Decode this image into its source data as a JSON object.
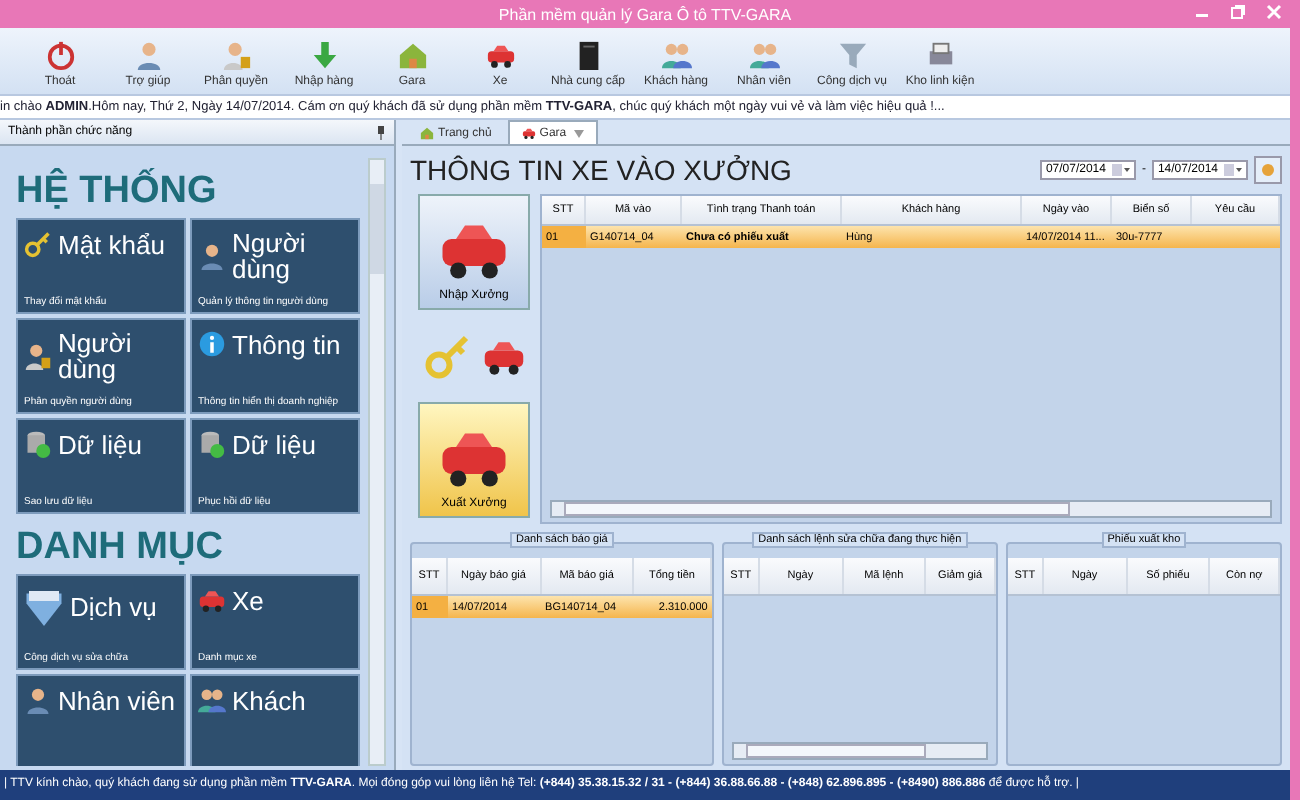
{
  "window": {
    "title": "Phần mềm quản lý Gara Ô tô TTV-GARA"
  },
  "toolbar": {
    "buttons": [
      {
        "label": "Thoát"
      },
      {
        "label": "Trợ giúp"
      },
      {
        "label": "Phân quyền"
      },
      {
        "label": "Nhập hàng"
      },
      {
        "label": "Gara"
      },
      {
        "label": "Xe"
      },
      {
        "label": "Nhà cung cấp"
      },
      {
        "label": "Khách hàng"
      },
      {
        "label": "Nhân viên"
      },
      {
        "label": "Công dịch vụ"
      },
      {
        "label": "Kho linh kiện"
      }
    ]
  },
  "marquee": "in chào **ADMIN**.Hôm nay, Thứ 2, Ngày 14/07/2014. Cám ơn quý khách đã sử dụng phần mềm **TTV-GARA**, chúc quý khách một ngày vui vẻ và làm  việc hiệu quả !...",
  "left_panel": {
    "title": "Thành phần chức năng",
    "sections": [
      {
        "heading": "HỆ THỐNG",
        "tiles": [
          {
            "title": "Mật khẩu",
            "caption": "Thay đổi mật khẩu"
          },
          {
            "title": "Người dùng",
            "caption": "Quản lý thông tin người dùng"
          },
          {
            "title": "Người dùng",
            "caption": "Phân quyền người dùng"
          },
          {
            "title": "Thông tin",
            "caption": "Thông tin hiển thị doanh nghiệp"
          },
          {
            "title": "Dữ liệu",
            "caption": "Sao lưu dữ liệu"
          },
          {
            "title": "Dữ liệu",
            "caption": "Phục hồi dữ liệu"
          }
        ]
      },
      {
        "heading": "DANH MỤC",
        "tiles": [
          {
            "title": "Dịch vụ",
            "caption": "Công dịch vụ sửa chữa"
          },
          {
            "title": "Xe",
            "caption": "Danh mục xe"
          },
          {
            "title": "Nhân viên"
          },
          {
            "title": "Khách"
          }
        ]
      }
    ]
  },
  "tabs": [
    {
      "label": "Trang chủ",
      "selected": false
    },
    {
      "label": "Gara",
      "selected": true
    }
  ],
  "main": {
    "title": "THÔNG TIN XE VÀO XƯỞNG",
    "date_from": "07/07/2014",
    "date_separator": "-",
    "date_to": "14/07/2014",
    "side_buttons": [
      {
        "kind": "entry",
        "label": "Nhập Xưởng"
      },
      {
        "kind": "tools"
      },
      {
        "kind": "exit",
        "label": "Xuất Xưởng"
      }
    ],
    "table": {
      "columns": [
        "STT",
        "Mã vào",
        "Tình trạng Thanh toán",
        "Khách hàng",
        "Ngày vào",
        "Biển số",
        "Yêu cầu"
      ],
      "rows": [
        {
          "selected": true,
          "cells": [
            "01",
            "G140714_04",
            "Chưa có phiếu xuất",
            "Hùng",
            "14/07/2014 11...",
            "30u-7777"
          ]
        }
      ]
    },
    "panels": [
      {
        "title": "Danh sách báo giá",
        "columns": [
          "STT",
          "Ngày báo giá",
          "Mã báo giá",
          "Tổng tiền"
        ],
        "rows": [
          {
            "selected": true,
            "cells": [
              "01",
              "14/07/2014",
              "BG140714_04",
              "2.310.000"
            ]
          }
        ]
      },
      {
        "title": "Danh sách lệnh sửa chữa đang thực hiện",
        "columns": [
          "STT",
          "Ngày",
          "Mã lệnh",
          "Giảm giá"
        ]
      },
      {
        "title": "Phiếu xuất kho",
        "columns": [
          "STT",
          "Ngày",
          "Số phiếu",
          "Còn nợ"
        ]
      }
    ]
  },
  "status_bar": "| TTV kính chào, quý khách đang sử dụng phần mềm **TTV-GARA**. Mọi đóng góp vui lòng liên hệ Tel: **(+844) 35.38.15.32 / 31 - (+844) 36.88.66.88 - (+848) 62.896.895 - (+8490) 886.886** để được hỗ trợ. |"
}
